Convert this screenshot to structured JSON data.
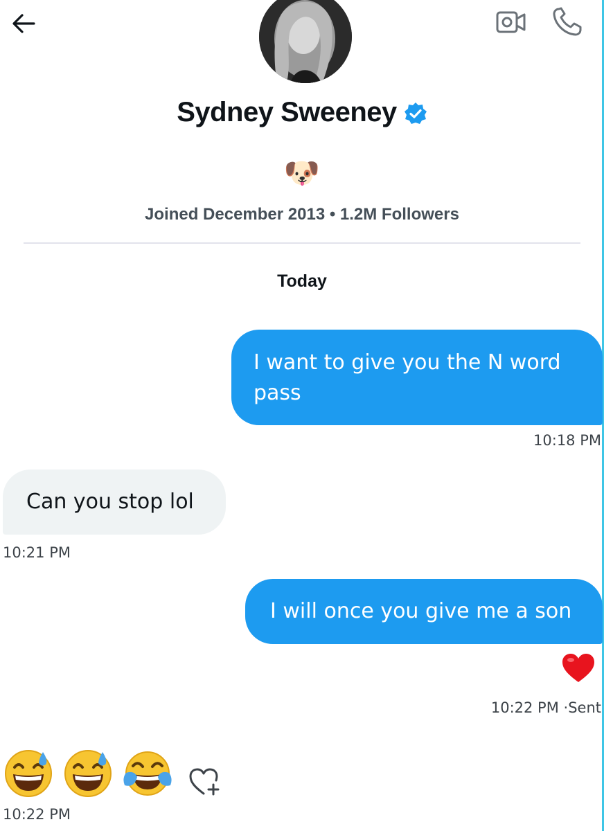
{
  "header": {
    "back_icon": "arrow-left-icon",
    "video_icon": "video-camera-icon",
    "call_icon": "phone-icon"
  },
  "profile": {
    "name": "Sydney Sweeney",
    "verified": true,
    "verified_color": "#1d9bf0",
    "bio_emoji": "🐶",
    "meta": "Joined December 2013 • 1.2M Followers"
  },
  "conversation": {
    "day_label": "Today",
    "messages": [
      {
        "direction": "sent",
        "text": "I want to give you the N word pass",
        "time": "10:18 PM"
      },
      {
        "direction": "received",
        "text": "Can you stop lol",
        "time": "10:21 PM"
      },
      {
        "direction": "sent",
        "text": "I will once you give me a son",
        "reaction": "red-heart",
        "time": "10:22 PM",
        "status": "Sent"
      },
      {
        "direction": "received",
        "emojis": [
          "sweat-smile-emoji",
          "sweat-smile-emoji",
          "tears-of-joy-emoji"
        ],
        "time": "10:22 PM"
      }
    ],
    "status_separator": " ·",
    "add_reaction_icon": "heart-plus-icon"
  },
  "colors": {
    "sent_bubble": "#1d9bf0",
    "received_bubble": "#eff3f4",
    "accent_edge": "#3fc6e6"
  }
}
